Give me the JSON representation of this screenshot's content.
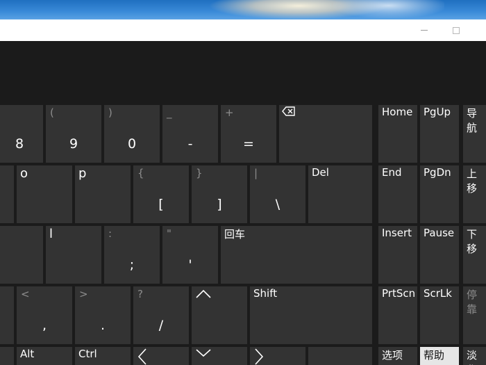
{
  "window": {
    "minimize_icon": "minimize-icon",
    "maximize_icon": "maximize-icon"
  },
  "keys": {
    "row1": [
      {
        "top": "",
        "main": "8"
      },
      {
        "top": "(",
        "main": "9"
      },
      {
        "top": ")",
        "main": "0"
      },
      {
        "top": "_",
        "main": "-"
      },
      {
        "top": "+",
        "main": "="
      }
    ],
    "row2": [
      {
        "label": "o"
      },
      {
        "label": "p"
      },
      {
        "top": "{",
        "main": "["
      },
      {
        "top": "}",
        "main": "]"
      },
      {
        "top": "|",
        "main": "\\"
      },
      {
        "label": "Del"
      }
    ],
    "row3": [
      {
        "label": "l"
      },
      {
        "top": ":",
        "main": ";"
      },
      {
        "top": "\"",
        "main": "'"
      },
      {
        "label": "回车"
      }
    ],
    "row4": [
      {
        "top": "<",
        "main": ","
      },
      {
        "top": ">",
        "main": "."
      },
      {
        "top": "?",
        "main": "/"
      },
      {
        "label": "Shift"
      }
    ],
    "row5": [
      {
        "label": "Alt"
      },
      {
        "label": "Ctrl"
      }
    ],
    "nav": {
      "home": "Home",
      "pgup": "PgUp",
      "nav": "导航",
      "end": "End",
      "pgdn": "PgDn",
      "up": "上移",
      "insert": "Insert",
      "pause": "Pause",
      "down": "下移",
      "prtscn": "PrtScn",
      "scrlk": "ScrLk",
      "dock": "停靠",
      "options": "选项",
      "help": "帮助",
      "fade": "淡化"
    },
    "colors": {
      "key": "#333333",
      "board": "#1b1b1b",
      "highlight": "#e6e6e6"
    }
  }
}
